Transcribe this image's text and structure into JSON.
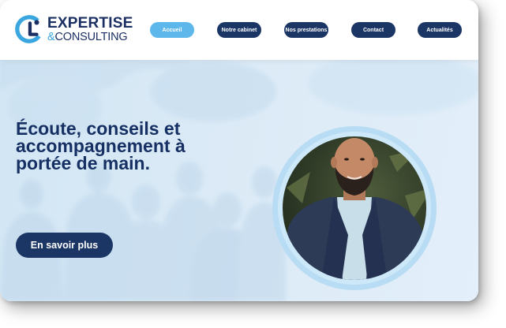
{
  "brand": {
    "logo_icon": "ec-logo-mark",
    "line1": "EXPERTISE",
    "line2_amp": "&",
    "line2_rest": "CONSULTING",
    "colors": {
      "navy": "#1b3565",
      "sky": "#5db7ea",
      "hero_bg": "#d8e9f5"
    }
  },
  "nav": {
    "items": [
      {
        "label": "Accueil",
        "active": true
      },
      {
        "label": "Notre cabinet",
        "active": false
      },
      {
        "label": "Nos prestations",
        "active": false
      },
      {
        "label": "Contact",
        "active": false
      },
      {
        "label": "Actualités",
        "active": false
      }
    ]
  },
  "hero": {
    "headline_line1": "Écoute, conseils et",
    "headline_line2": "accompagnement à",
    "headline_line3": "portée de main.",
    "cta_label": "En savoir plus"
  }
}
